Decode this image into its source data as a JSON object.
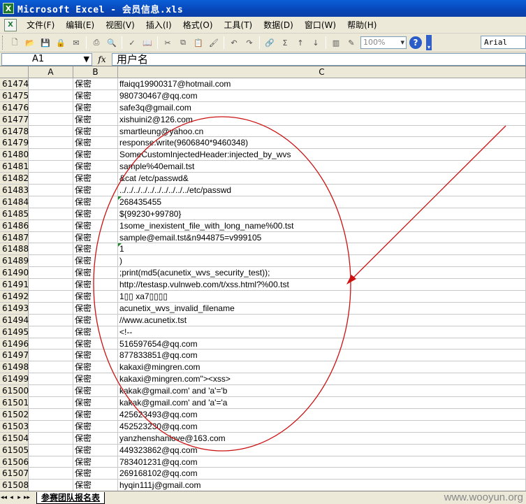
{
  "window": {
    "title": "Microsoft Excel - 会员信息.xls"
  },
  "menu": [
    "文件(F)",
    "编辑(E)",
    "视图(V)",
    "插入(I)",
    "格式(O)",
    "工具(T)",
    "数据(D)",
    "窗口(W)",
    "帮助(H)"
  ],
  "toolbar": {
    "zoom": "100%",
    "font": "Arial"
  },
  "formula": {
    "cell_ref": "A1",
    "fx": "fx",
    "content": "用户名"
  },
  "columns": [
    "A",
    "B",
    "C"
  ],
  "rows": [
    {
      "n": "61474",
      "b": "保密",
      "c": "ffaiqq19900317@hotmail.com"
    },
    {
      "n": "61475",
      "b": "保密",
      "c": "980730467@qq.com"
    },
    {
      "n": "61476",
      "b": "保密",
      "c": "safe3q@gmail.com"
    },
    {
      "n": "61477",
      "b": "保密",
      "c": "xishuini2@126.com"
    },
    {
      "n": "61478",
      "b": "保密",
      "c": "smartleung@yahoo.cn"
    },
    {
      "n": "61479",
      "b": "保密",
      "c": "response.write(9606840*9460348)"
    },
    {
      "n": "61480",
      "b": "保密",
      "c": " SomeCustomInjectedHeader:injected_by_wvs"
    },
    {
      "n": "61481",
      "b": "保密",
      "c": "sample%40email.tst"
    },
    {
      "n": "61482",
      "b": "保密",
      "c": "&cat /etc/passwd&"
    },
    {
      "n": "61483",
      "b": "保密",
      "c": "../../../../../../../../../../etc/passwd"
    },
    {
      "n": "61484",
      "b": "保密",
      "c": "268435455",
      "tri": true
    },
    {
      "n": "61485",
      "b": "保密",
      "c": "${99230+99780}"
    },
    {
      "n": "61486",
      "b": "保密",
      "c": "1some_inexistent_file_with_long_name%00.tst"
    },
    {
      "n": "61487",
      "b": "保密",
      "c": "sample@email.tst&n944875=v999105"
    },
    {
      "n": "61488",
      "b": "保密",
      "c": "1",
      "tri": true
    },
    {
      "n": "61489",
      "b": "保密",
      "c": ")"
    },
    {
      "n": "61490",
      "b": "保密",
      "c": ";print(md5(acunetix_wvs_security_test));"
    },
    {
      "n": "61491",
      "b": "保密",
      "c": "http://testasp.vulnweb.com/t/xss.html?%00.tst"
    },
    {
      "n": "61492",
      "b": "保密",
      "c": "1▯▯ xa7▯▯▯▯"
    },
    {
      "n": "61493",
      "b": "保密",
      "c": "acunetix_wvs_invalid_filename"
    },
    {
      "n": "61494",
      "b": "保密",
      "c": "//www.acunetix.tst"
    },
    {
      "n": "61495",
      "b": "保密",
      "c": "<!--"
    },
    {
      "n": "61496",
      "b": "保密",
      "c": "516597654@qq.com"
    },
    {
      "n": "61497",
      "b": "保密",
      "c": "877833851@qq.com"
    },
    {
      "n": "61498",
      "b": "保密",
      "c": "kakaxi@mingren.com"
    },
    {
      "n": "61499",
      "b": "保密",
      "c": "kakaxi@mingren.com\"><xss>"
    },
    {
      "n": "61500",
      "b": "保密",
      "c": "kakak@gmail.com' and 'a'='b"
    },
    {
      "n": "61501",
      "b": "保密",
      "c": "kakak@gmail.com' and 'a'='a"
    },
    {
      "n": "61502",
      "b": "保密",
      "c": "425623493@qq.com"
    },
    {
      "n": "61503",
      "b": "保密",
      "c": "452523230@qq.com"
    },
    {
      "n": "61504",
      "b": "保密",
      "c": "yanzhenshanlove@163.com"
    },
    {
      "n": "61505",
      "b": "保密",
      "c": "449323862@qq.com"
    },
    {
      "n": "61506",
      "b": "保密",
      "c": "783401231@qq.com"
    },
    {
      "n": "61507",
      "b": "保密",
      "c": "269168102@qq.com"
    },
    {
      "n": "61508",
      "b": "保密",
      "c": "hyqin111j@gmail.com"
    }
  ],
  "sheet": {
    "tab": "参赛团队报名表",
    "nav": [
      "◂◂",
      "◂",
      "▸",
      "▸▸"
    ]
  },
  "watermark": "www.wooyun.org",
  "annotation_color": "#cc1111"
}
